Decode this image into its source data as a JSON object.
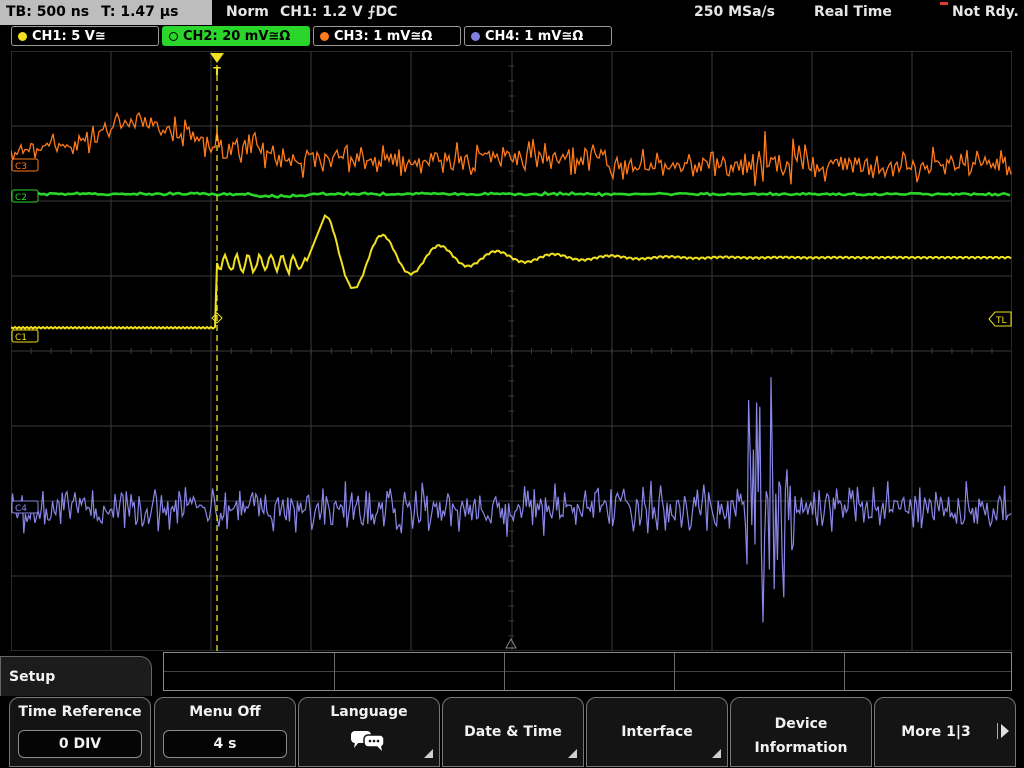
{
  "topbar": {
    "timebase": "TB: 500 ns",
    "trigger_time": "T: 1.47 µs",
    "trigger_mode": "Norm",
    "trigger_setting": "CH1: 1.2 V ⨍DC",
    "sample_rate": "250 MSa/s",
    "acq_mode": "Real Time",
    "status": "Not Rdy."
  },
  "channels": [
    {
      "label": "CH1: 5 V≅",
      "color": "#f0e020"
    },
    {
      "label": "CH2: 20 mV≅Ω",
      "color": "#2bd62b"
    },
    {
      "label": "CH3: 1 mV≅Ω",
      "color": "#ff7a1a"
    },
    {
      "label": "CH4: 1 mV≅Ω",
      "color": "#8080e0"
    }
  ],
  "scope": {
    "grid_color": "#3a3a3a",
    "trigger_marker": "T",
    "markers": {
      "c3": "C3",
      "c2": "C2",
      "c1": "C1",
      "c4": "C4",
      "tl": "TL"
    }
  },
  "menu": {
    "title": "Setup",
    "softkeys": [
      {
        "label": "Time Reference",
        "value": "0 DIV"
      },
      {
        "label": "Menu Off",
        "value": "4 s"
      },
      {
        "label": "Language",
        "icon": "speech-bubbles-icon"
      },
      {
        "label": "Date & Time"
      },
      {
        "label": "Interface"
      },
      {
        "label": "Device Information"
      },
      {
        "label": "More 1|3"
      }
    ]
  }
}
